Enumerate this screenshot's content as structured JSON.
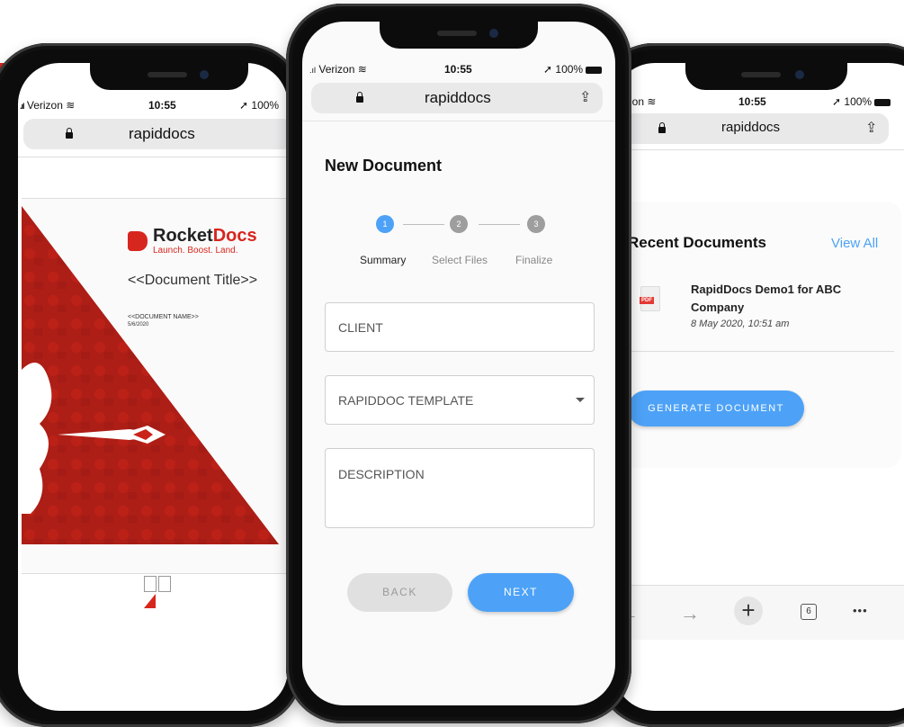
{
  "left_phone": {
    "status": {
      "carrier": "Verizon",
      "time": "10:55",
      "battery": "100%"
    },
    "url": "rapiddocs",
    "doc": {
      "brand_part1": "Rocket",
      "brand_part2": "Docs",
      "tagline": "Launch. Boost. Land.",
      "title": "<<Document Title>>",
      "name_placeholder": "<<DOCUMENT NAME>>",
      "date": "5/6/2020"
    }
  },
  "center_phone": {
    "status": {
      "carrier": "Verizon",
      "time": "10:55",
      "battery": "100%"
    },
    "url": "rapiddocs",
    "heading": "New Document",
    "steps": [
      {
        "num": "1",
        "label": "Summary"
      },
      {
        "num": "2",
        "label": "Select Files"
      },
      {
        "num": "3",
        "label": "Finalize"
      }
    ],
    "fields": {
      "client": "CLIENT",
      "template": "RAPIDDOC TEMPLATE",
      "description": "DESCRIPTION"
    },
    "buttons": {
      "back": "BACK",
      "next": "NEXT"
    }
  },
  "right_phone": {
    "status": {
      "carrier": "Verizon",
      "time": "10:55",
      "battery": "100%"
    },
    "url": "rapiddocs",
    "heading": "Recent Documents",
    "view_all": "View All",
    "document": {
      "badge": "PDF",
      "title_line1": "RapidDocs Demo1 for ABC",
      "title_line2": "Company",
      "date": "8 May 2020, 10:51 am"
    },
    "generate": "GENERATE DOCUMENT",
    "toolbar": {
      "back": "←",
      "forward": "→",
      "add": "+",
      "tabs": "6",
      "more": "•••"
    }
  },
  "colors": {
    "accent": "#4da2f7",
    "brand_red": "#d7261e",
    "disabled": "#e0e0e0"
  }
}
